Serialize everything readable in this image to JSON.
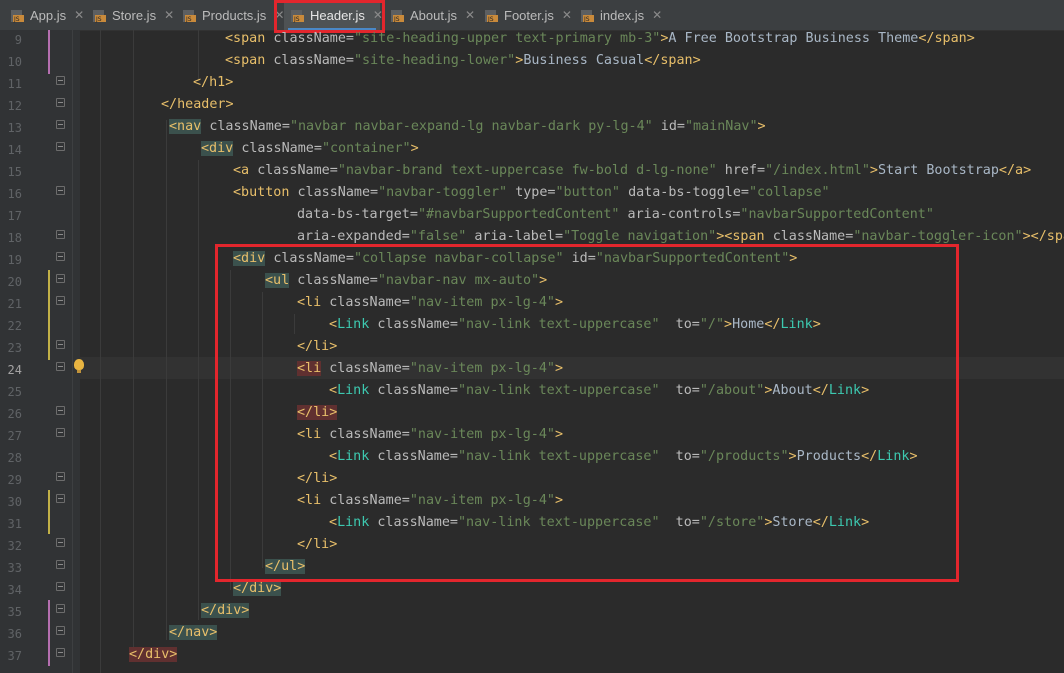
{
  "tabs": [
    {
      "label": "App.js",
      "active": false
    },
    {
      "label": "Store.js",
      "active": false
    },
    {
      "label": "Products.js",
      "active": false
    },
    {
      "label": "Header.js",
      "active": true
    },
    {
      "label": "About.js",
      "active": false
    },
    {
      "label": "Footer.js",
      "active": false
    },
    {
      "label": "index.js",
      "active": false
    }
  ],
  "editor": {
    "current_line": 24,
    "lines": [
      {
        "n": 9,
        "text": "<span className=\"site-heading-upper text-primary mb-3\">A Free Bootstrap Business Theme</span>"
      },
      {
        "n": 10,
        "text": "<span className=\"site-heading-lower\">Business Casual</span>"
      },
      {
        "n": 11,
        "text": "</h1>"
      },
      {
        "n": 12,
        "text": "</header>"
      },
      {
        "n": 13,
        "text": "<nav className=\"navbar navbar-expand-lg navbar-dark py-lg-4\" id=\"mainNav\">"
      },
      {
        "n": 14,
        "text": "<div className=\"container\">"
      },
      {
        "n": 15,
        "text": "<a className=\"navbar-brand text-uppercase fw-bold d-lg-none\" href=\"/index.html\">Start Bootstrap</a>"
      },
      {
        "n": 16,
        "text": "<button className=\"navbar-toggler\" type=\"button\" data-bs-toggle=\"collapse\""
      },
      {
        "n": 17,
        "text": "data-bs-target=\"#navbarSupportedContent\" aria-controls=\"navbarSupportedContent\""
      },
      {
        "n": 18,
        "text": "aria-expanded=\"false\" aria-label=\"Toggle navigation\"><span className=\"navbar-toggler-icon\"></spa"
      },
      {
        "n": 19,
        "text": "<div className=\"collapse navbar-collapse\" id=\"navbarSupportedContent\">"
      },
      {
        "n": 20,
        "text": "<ul className=\"navbar-nav mx-auto\">"
      },
      {
        "n": 21,
        "text": "<li className=\"nav-item px-lg-4\">"
      },
      {
        "n": 22,
        "text": "<Link className=\"nav-link text-uppercase\" to=\"/\">Home</Link>"
      },
      {
        "n": 23,
        "text": "</li>"
      },
      {
        "n": 24,
        "text": "<li className=\"nav-item px-lg-4\">"
      },
      {
        "n": 25,
        "text": "<Link className=\"nav-link text-uppercase\" to=\"/about\">About</Link>"
      },
      {
        "n": 26,
        "text": "</li>"
      },
      {
        "n": 27,
        "text": "<li className=\"nav-item px-lg-4\">"
      },
      {
        "n": 28,
        "text": "<Link className=\"nav-link text-uppercase\" to=\"/products\">Products</Link>"
      },
      {
        "n": 29,
        "text": "</li>"
      },
      {
        "n": 30,
        "text": "<li className=\"nav-item px-lg-4\">"
      },
      {
        "n": 31,
        "text": "<Link className=\"nav-link text-uppercase\" to=\"/store\">Store</Link>"
      },
      {
        "n": 32,
        "text": "</li>"
      },
      {
        "n": 33,
        "text": "</ul>"
      },
      {
        "n": 34,
        "text": "</div>"
      },
      {
        "n": 35,
        "text": "</div>"
      },
      {
        "n": 36,
        "text": "</nav>"
      },
      {
        "n": 37,
        "text": "</div>"
      }
    ]
  },
  "colors": {
    "tag": "#e8bf6a",
    "attribute": "#bababa",
    "string": "#6a8759",
    "component": "#3dc9b0",
    "highlight_box": "#e3262d"
  }
}
